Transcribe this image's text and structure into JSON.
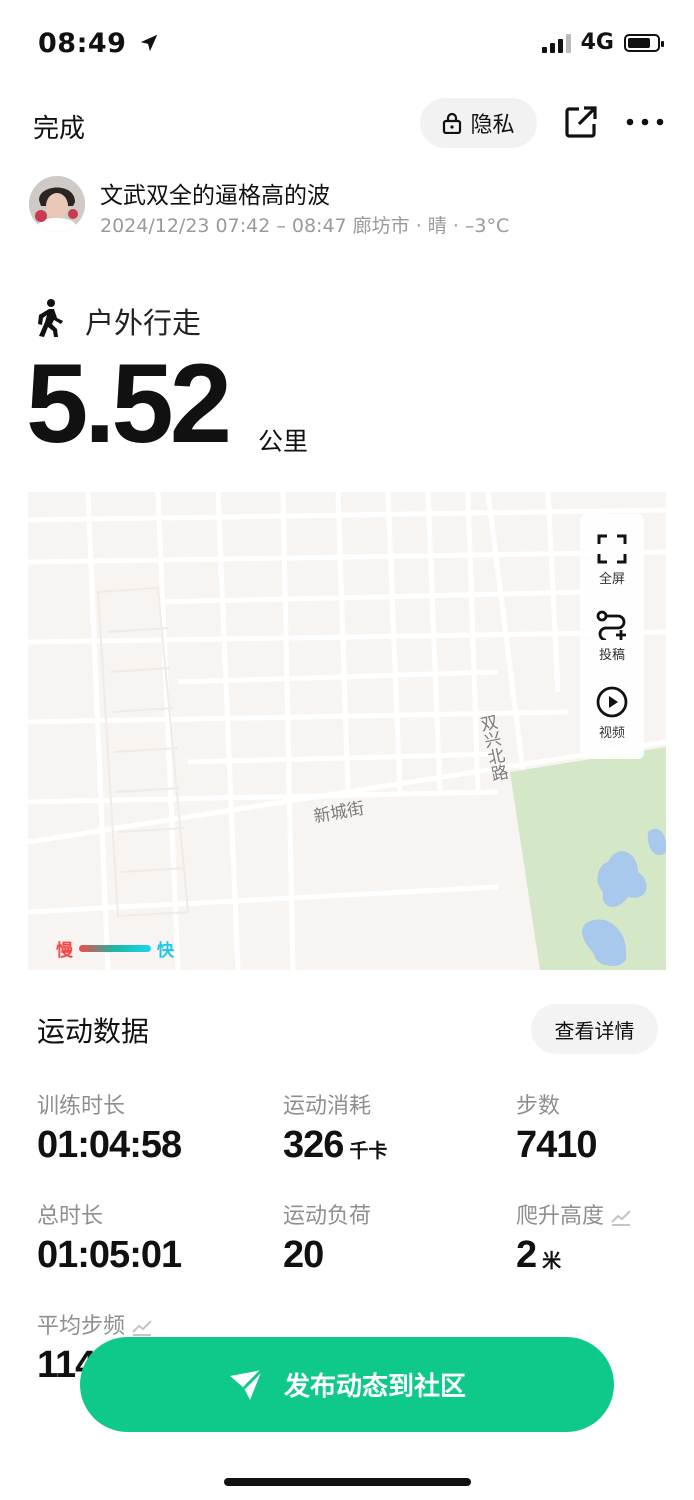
{
  "status": {
    "time": "08:49",
    "network": "4G"
  },
  "header": {
    "done_label": "完成",
    "privacy_label": "隐私"
  },
  "user": {
    "name": "文武双全的逼格高的波",
    "meta": "2024/12/23 07:42 – 08:47 廊坊市 · 晴 · –3°C"
  },
  "activity": {
    "type": "户外行走",
    "distance": "5.52",
    "unit": "公里"
  },
  "map": {
    "controls": [
      {
        "label": "全屏",
        "icon": "fullscreen-icon"
      },
      {
        "label": "投稿",
        "icon": "route-icon"
      },
      {
        "label": "视频",
        "icon": "play-icon"
      }
    ],
    "street_1": "新城街",
    "street_2": "双兴北路",
    "legend_slow": "慢",
    "legend_fast": "快"
  },
  "stats": {
    "title": "运动数据",
    "detail_label": "查看详情",
    "items": [
      {
        "label": "训练时长",
        "value": "01:04:58",
        "unit": ""
      },
      {
        "label": "运动消耗",
        "value": "326",
        "unit": "千卡"
      },
      {
        "label": "步数",
        "value": "7410",
        "unit": ""
      },
      {
        "label": "总时长",
        "value": "01:05:01",
        "unit": ""
      },
      {
        "label": "运动负荷",
        "value": "20",
        "unit": ""
      },
      {
        "label": "爬升高度",
        "value": "2",
        "unit": "米"
      },
      {
        "label": "平均步频",
        "value": "114",
        "unit": ""
      }
    ]
  },
  "publish_label": "发布动态到社区",
  "colors": {
    "accent": "#0ec98a",
    "slow": "#f24a4a",
    "fast": "#1fd4f0",
    "park": "#d4e8c8",
    "water": "#a8c9ec"
  }
}
